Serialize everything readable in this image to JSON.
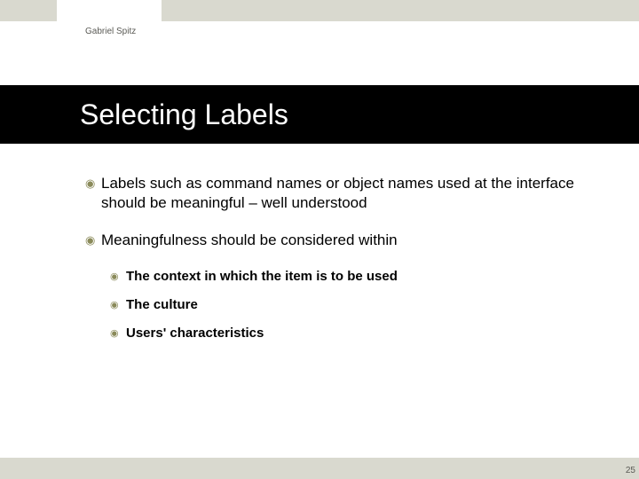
{
  "author": "Gabriel Spitz",
  "title": "Selecting Labels",
  "bullets": [
    {
      "level": 1,
      "text": "Labels such as command names or object names used at the interface should be meaningful – well understood"
    },
    {
      "level": 1,
      "text": "Meaningfulness should be considered within"
    },
    {
      "level": 2,
      "text": "The context in which the item is to be used"
    },
    {
      "level": 2,
      "text": "The culture"
    },
    {
      "level": 2,
      "text": "Users' characteristics"
    }
  ],
  "page_number": "25"
}
